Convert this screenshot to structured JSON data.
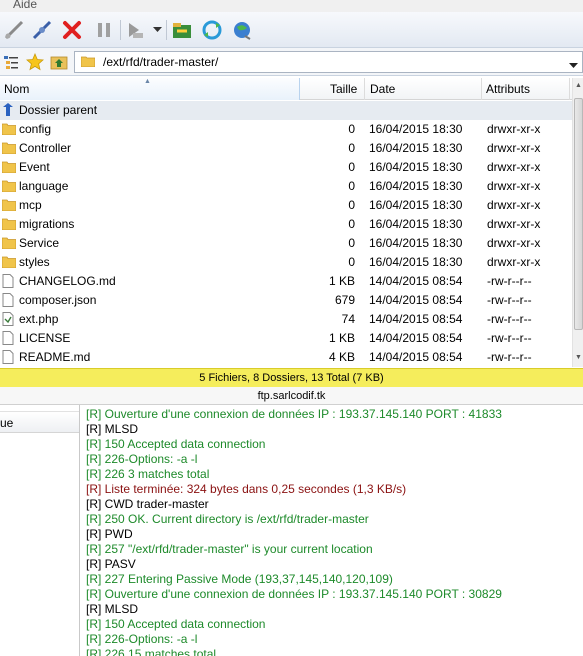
{
  "menu": {
    "items": [
      "Aide"
    ]
  },
  "toolbar": {
    "buttons": [
      "connect-icon",
      "disconnect-icon",
      "abort-icon",
      "pause-icon",
      "transfer-icon",
      "dropdown-icon",
      "refresh-folder-icon",
      "sync-icon",
      "web-icon"
    ]
  },
  "address": {
    "value": "/ext/rfd/trader-master/"
  },
  "columns": {
    "name": "Nom",
    "size": "Taille",
    "date": "Date",
    "attributes": "Attributs"
  },
  "files": [
    {
      "name": "Dossier parent",
      "size": "",
      "date": "",
      "attr": "",
      "type": "parent"
    },
    {
      "name": "config",
      "size": "0",
      "date": "16/04/2015 18:30",
      "attr": "drwxr-xr-x",
      "type": "folder"
    },
    {
      "name": "Controller",
      "size": "0",
      "date": "16/04/2015 18:30",
      "attr": "drwxr-xr-x",
      "type": "folder"
    },
    {
      "name": "Event",
      "size": "0",
      "date": "16/04/2015 18:30",
      "attr": "drwxr-xr-x",
      "type": "folder"
    },
    {
      "name": "language",
      "size": "0",
      "date": "16/04/2015 18:30",
      "attr": "drwxr-xr-x",
      "type": "folder"
    },
    {
      "name": "mcp",
      "size": "0",
      "date": "16/04/2015 18:30",
      "attr": "drwxr-xr-x",
      "type": "folder"
    },
    {
      "name": "migrations",
      "size": "0",
      "date": "16/04/2015 18:30",
      "attr": "drwxr-xr-x",
      "type": "folder"
    },
    {
      "name": "Service",
      "size": "0",
      "date": "16/04/2015 18:30",
      "attr": "drwxr-xr-x",
      "type": "folder"
    },
    {
      "name": "styles",
      "size": "0",
      "date": "16/04/2015 18:30",
      "attr": "drwxr-xr-x",
      "type": "folder"
    },
    {
      "name": "CHANGELOG.md",
      "size": "1 KB",
      "date": "14/04/2015 08:54",
      "attr": "-rw-r--r--",
      "type": "file"
    },
    {
      "name": "composer.json",
      "size": "679",
      "date": "14/04/2015 08:54",
      "attr": "-rw-r--r--",
      "type": "file"
    },
    {
      "name": "ext.php",
      "size": "74",
      "date": "14/04/2015 08:54",
      "attr": "-rw-r--r--",
      "type": "php"
    },
    {
      "name": "LICENSE",
      "size": "1 KB",
      "date": "14/04/2015 08:54",
      "attr": "-rw-r--r--",
      "type": "file"
    },
    {
      "name": "README.md",
      "size": "4 KB",
      "date": "14/04/2015 08:54",
      "attr": "-rw-r--r--",
      "type": "file"
    }
  ],
  "status": {
    "summary": "5 Fichiers, 8 Dossiers, 13 Total (7 KB)",
    "host": "ftp.sarlcodif.tk"
  },
  "left_pane": {
    "header": "ue"
  },
  "log": [
    {
      "text": "[R] Ouverture d'une connexion de données IP : 193.37.145.140 PORT : 41833",
      "color": "green"
    },
    {
      "text": "[R] MLSD",
      "color": "black"
    },
    {
      "text": "[R] 150 Accepted data connection",
      "color": "green"
    },
    {
      "text": "[R] 226-Options: -a -l",
      "color": "green"
    },
    {
      "text": "[R] 226 3 matches total",
      "color": "green"
    },
    {
      "text": "[R] Liste terminée: 324 bytes dans 0,25 secondes (1,3 KB/s)",
      "color": "red"
    },
    {
      "text": "[R] CWD trader-master",
      "color": "black"
    },
    {
      "text": "[R] 250 OK. Current directory is /ext/rfd/trader-master",
      "color": "green"
    },
    {
      "text": "[R] PWD",
      "color": "black"
    },
    {
      "text": "[R] 257 \"/ext/rfd/trader-master\" is your current location",
      "color": "green"
    },
    {
      "text": "[R] PASV",
      "color": "black"
    },
    {
      "text": "[R] 227 Entering Passive Mode (193,37,145,140,120,109)",
      "color": "green"
    },
    {
      "text": "[R] Ouverture d'une connexion de données IP : 193.37.145.140 PORT : 30829",
      "color": "green"
    },
    {
      "text": "[R] MLSD",
      "color": "black"
    },
    {
      "text": "[R] 150 Accepted data connection",
      "color": "green"
    },
    {
      "text": "[R] 226-Options: -a -l",
      "color": "green"
    },
    {
      "text": "[R] 226 15 matches total",
      "color": "green"
    }
  ]
}
